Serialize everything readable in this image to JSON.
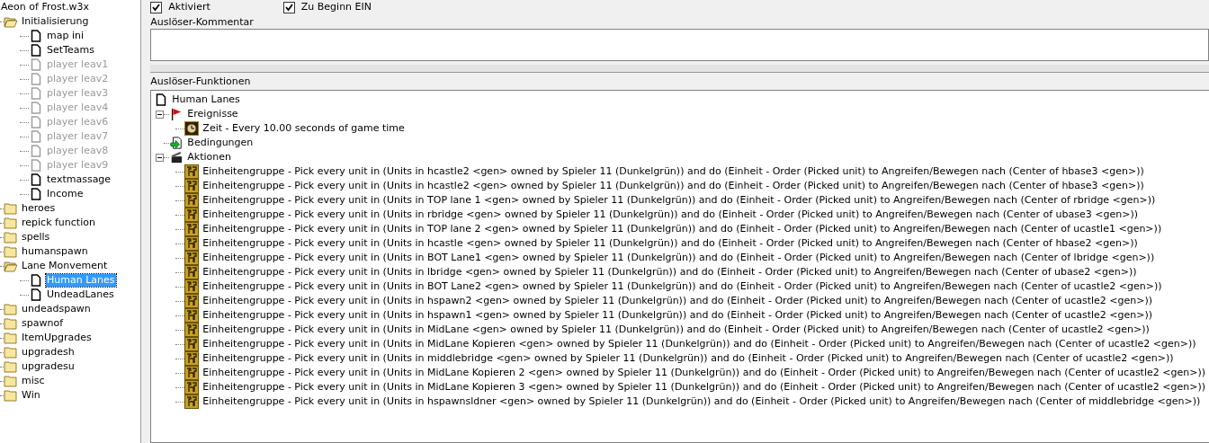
{
  "trigger_tree": {
    "root": "Aeon of Frost.w3x",
    "items": [
      {
        "label": "Initialisierung",
        "kind": "folder",
        "expanded": true,
        "children": [
          {
            "label": "map ini",
            "kind": "trigger",
            "disabled": false,
            "selected": false
          },
          {
            "label": "SetTeams",
            "kind": "trigger",
            "disabled": false,
            "selected": false
          },
          {
            "label": "player leav1",
            "kind": "trigger",
            "disabled": true,
            "selected": false
          },
          {
            "label": "player leav2",
            "kind": "trigger",
            "disabled": true,
            "selected": false
          },
          {
            "label": "player leav3",
            "kind": "trigger",
            "disabled": true,
            "selected": false
          },
          {
            "label": "player leav4",
            "kind": "trigger",
            "disabled": true,
            "selected": false
          },
          {
            "label": "player leav6",
            "kind": "trigger",
            "disabled": true,
            "selected": false
          },
          {
            "label": "player leav7",
            "kind": "trigger",
            "disabled": true,
            "selected": false
          },
          {
            "label": "player leav8",
            "kind": "trigger",
            "disabled": true,
            "selected": false
          },
          {
            "label": "player leav9",
            "kind": "trigger",
            "disabled": true,
            "selected": false
          },
          {
            "label": "textmassage",
            "kind": "trigger",
            "disabled": false,
            "selected": false
          },
          {
            "label": "Income",
            "kind": "trigger",
            "disabled": false,
            "selected": false
          }
        ]
      },
      {
        "label": "heroes",
        "kind": "folder",
        "expanded": false
      },
      {
        "label": "repick function",
        "kind": "folder",
        "expanded": false
      },
      {
        "label": "spells",
        "kind": "folder",
        "expanded": false
      },
      {
        "label": "humanspawn",
        "kind": "folder",
        "expanded": false
      },
      {
        "label": "Lane Monvement",
        "kind": "folder",
        "expanded": true,
        "children": [
          {
            "label": "Human Lanes",
            "kind": "trigger",
            "disabled": false,
            "selected": true
          },
          {
            "label": "UndeadLanes",
            "kind": "trigger",
            "disabled": false,
            "selected": false
          }
        ]
      },
      {
        "label": "undeadspawn",
        "kind": "folder",
        "expanded": false
      },
      {
        "label": "spawnof",
        "kind": "folder",
        "expanded": false
      },
      {
        "label": "ItemUpgrades",
        "kind": "folder",
        "expanded": false
      },
      {
        "label": "upgradesh",
        "kind": "folder",
        "expanded": false
      },
      {
        "label": "upgradesu",
        "kind": "folder",
        "expanded": false
      },
      {
        "label": "misc",
        "kind": "folder",
        "expanded": false
      },
      {
        "label": "Win",
        "kind": "folder",
        "expanded": false
      }
    ]
  },
  "options": [
    {
      "label": "Aktiviert",
      "checked": true
    },
    {
      "label": "Zu Beginn EIN",
      "checked": true
    }
  ],
  "comment_label": "Auslöser-Kommentar",
  "functions_label": "Auslöser-Funktionen",
  "functions": {
    "title": "Human Lanes",
    "sections": [
      {
        "label": "Ereignisse",
        "kind": "events",
        "expanded": true,
        "children": [
          "Zeit - Every 10.00 seconds of game time"
        ]
      },
      {
        "label": "Bedingungen",
        "kind": "conditions"
      },
      {
        "label": "Aktionen",
        "kind": "actions",
        "expanded": true,
        "children": [
          "Einheitengruppe - Pick every unit in (Units in hcastle2 <gen> owned by Spieler 11 (Dunkelgrün)) and do (Einheit - Order (Picked unit) to Angreifen/Bewegen nach (Center of hbase3 <gen>))",
          "Einheitengruppe - Pick every unit in (Units in hcastle2 <gen> owned by Spieler 11 (Dunkelgrün)) and do (Einheit - Order (Picked unit) to Angreifen/Bewegen nach (Center of hbase3 <gen>))",
          "Einheitengruppe - Pick every unit in (Units in TOP lane 1 <gen> owned by Spieler 11 (Dunkelgrün)) and do (Einheit - Order (Picked unit) to Angreifen/Bewegen nach (Center of rbridge <gen>))",
          "Einheitengruppe - Pick every unit in (Units in rbridge <gen> owned by Spieler 11 (Dunkelgrün)) and do (Einheit - Order (Picked unit) to Angreifen/Bewegen nach (Center of ubase3 <gen>))",
          "Einheitengruppe - Pick every unit in (Units in TOP lane 2 <gen> owned by Spieler 11 (Dunkelgrün)) and do (Einheit - Order (Picked unit) to Angreifen/Bewegen nach (Center of ucastle1 <gen>))",
          "Einheitengruppe - Pick every unit in (Units in hcastle <gen> owned by Spieler 11 (Dunkelgrün)) and do (Einheit - Order (Picked unit) to Angreifen/Bewegen nach (Center of hbase2 <gen>))",
          "Einheitengruppe - Pick every unit in (Units in BOT Lane1 <gen> owned by Spieler 11 (Dunkelgrün)) and do (Einheit - Order (Picked unit) to Angreifen/Bewegen nach (Center of lbridge <gen>))",
          "Einheitengruppe - Pick every unit in (Units in lbridge <gen> owned by Spieler 11 (Dunkelgrün)) and do (Einheit - Order (Picked unit) to Angreifen/Bewegen nach (Center of ubase2 <gen>))",
          "Einheitengruppe - Pick every unit in (Units in BOT Lane2 <gen> owned by Spieler 11 (Dunkelgrün)) and do (Einheit - Order (Picked unit) to Angreifen/Bewegen nach (Center of ucastle2 <gen>))",
          "Einheitengruppe - Pick every unit in (Units in hspawn2 <gen> owned by Spieler 11 (Dunkelgrün)) and do (Einheit - Order (Picked unit) to Angreifen/Bewegen nach (Center of ucastle2 <gen>))",
          "Einheitengruppe - Pick every unit in (Units in hspawn1 <gen> owned by Spieler 11 (Dunkelgrün)) and do (Einheit - Order (Picked unit) to Angreifen/Bewegen nach (Center of ucastle2 <gen>))",
          "Einheitengruppe - Pick every unit in (Units in MidLane <gen> owned by Spieler 11 (Dunkelgrün)) and do (Einheit - Order (Picked unit) to Angreifen/Bewegen nach (Center of ucastle2 <gen>))",
          "Einheitengruppe - Pick every unit in (Units in MidLane Kopieren <gen> owned by Spieler 11 (Dunkelgrün)) and do (Einheit - Order (Picked unit) to Angreifen/Bewegen nach (Center of ucastle2 <gen>))",
          "Einheitengruppe - Pick every unit in (Units in middlebridge <gen> owned by Spieler 11 (Dunkelgrün)) and do (Einheit - Order (Picked unit) to Angreifen/Bewegen nach (Center of ucastle2 <gen>))",
          "Einheitengruppe - Pick every unit in (Units in MidLane Kopieren 2 <gen> owned by Spieler 11 (Dunkelgrün)) and do (Einheit - Order (Picked unit) to Angreifen/Bewegen nach (Center of ucastle2 <gen>))",
          "Einheitengruppe - Pick every unit in (Units in MidLane Kopieren 3 <gen> owned by Spieler 11 (Dunkelgrün)) and do (Einheit - Order (Picked unit) to Angreifen/Bewegen nach (Center of ucastle2 <gen>))",
          "Einheitengruppe - Pick every unit in (Units in hspawnsldner <gen> owned by Spieler 11 (Dunkelgrün)) and do (Einheit - Order (Picked unit) to Angreifen/Bewegen nach (Center of middlebridge <gen>))"
        ]
      }
    ]
  }
}
